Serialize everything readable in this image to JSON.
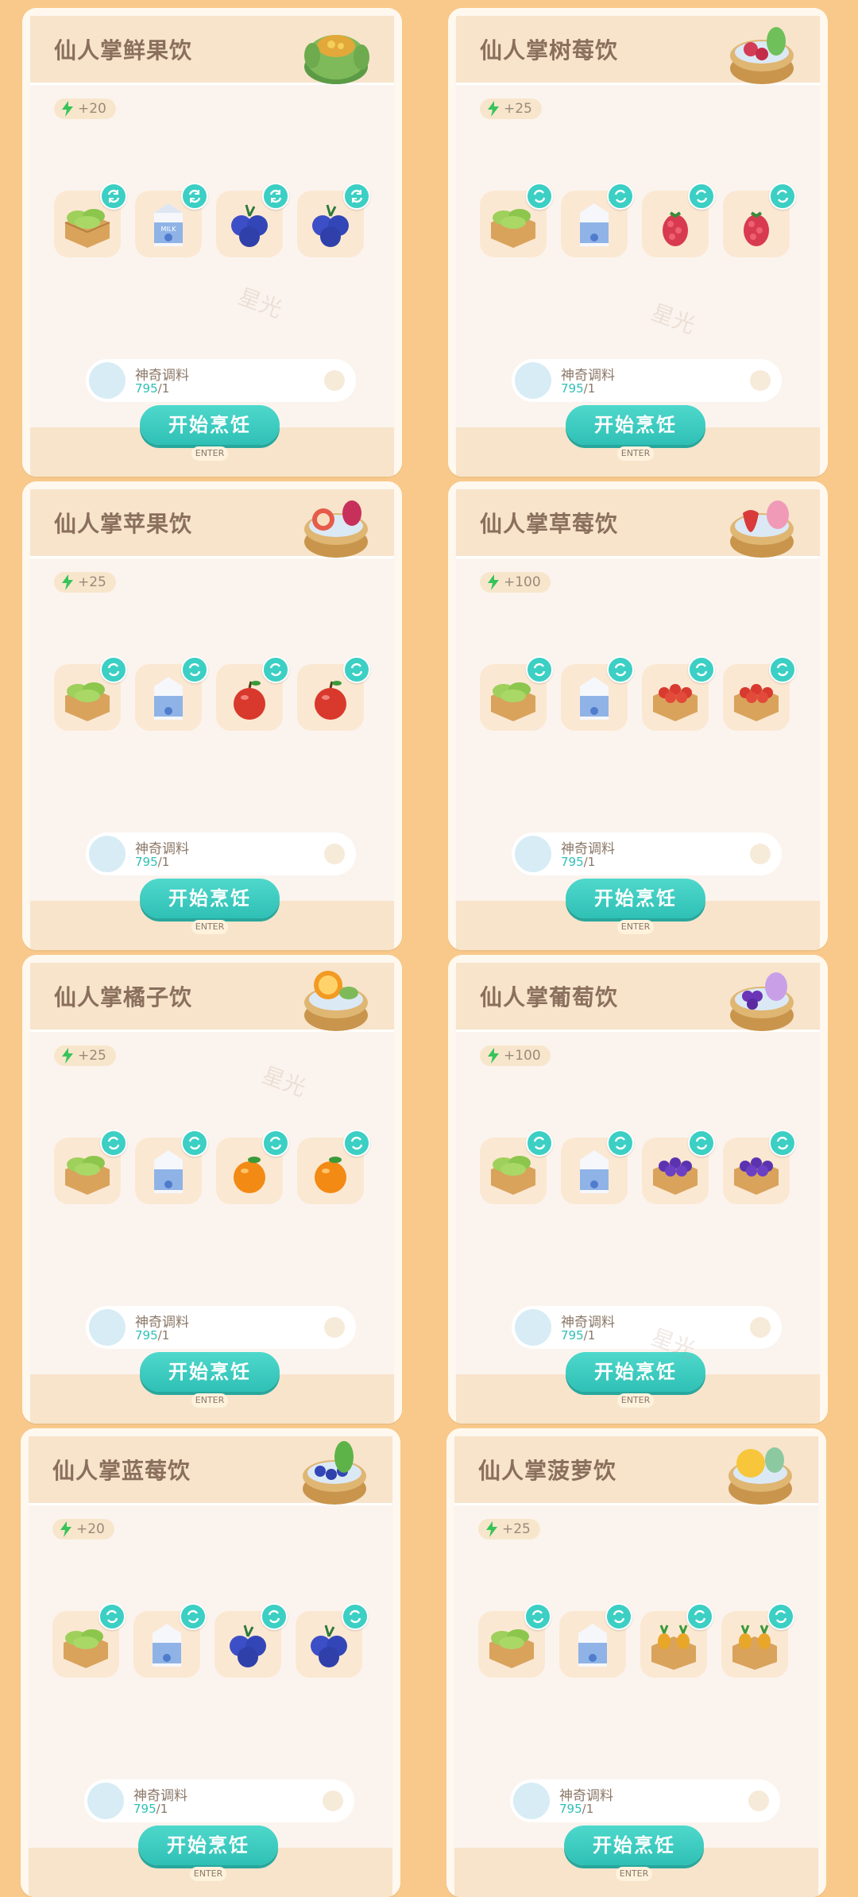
{
  "cards": [
    {
      "title": "仙人掌鲜果饮",
      "energy": "+20",
      "dish": "cactus-pot-icon",
      "ingredients": [
        "lettuce-crate-icon",
        "milk-carton-icon",
        "blueberry-icon",
        "blueberry-icon"
      ]
    },
    {
      "title": "仙人掌树莓饮",
      "energy": "+25",
      "dish": "raspberry-basket-icon",
      "ingredients": [
        "lettuce-crate-icon",
        "milk-carton-icon",
        "raspberry-icon",
        "raspberry-icon"
      ]
    },
    {
      "title": "仙人掌苹果饮",
      "energy": "+25",
      "dish": "apple-basket-icon",
      "ingredients": [
        "lettuce-crate-icon",
        "milk-carton-icon",
        "apple-icon",
        "apple-icon"
      ]
    },
    {
      "title": "仙人掌草莓饮",
      "energy": "+100",
      "dish": "strawberry-basket-icon",
      "ingredients": [
        "lettuce-crate-icon",
        "milk-carton-icon",
        "strawberry-crate-icon",
        "strawberry-crate-icon"
      ]
    },
    {
      "title": "仙人掌橘子饮",
      "energy": "+25",
      "dish": "orange-basket-icon",
      "ingredients": [
        "lettuce-crate-icon",
        "milk-carton-icon",
        "orange-icon",
        "orange-icon"
      ]
    },
    {
      "title": "仙人掌葡萄饮",
      "energy": "+100",
      "dish": "grape-basket-icon",
      "ingredients": [
        "lettuce-crate-icon",
        "milk-carton-icon",
        "grape-crate-icon",
        "grape-crate-icon"
      ]
    },
    {
      "title": "仙人掌蓝莓饮",
      "energy": "+20",
      "dish": "blueberry-basket-icon",
      "ingredients": [
        "lettuce-crate-icon",
        "milk-carton-icon",
        "blueberry-icon",
        "blueberry-icon"
      ]
    },
    {
      "title": "仙人掌菠萝饮",
      "energy": "+25",
      "dish": "pineapple-basket-icon",
      "ingredients": [
        "lettuce-crate-icon",
        "milk-carton-icon",
        "pineapple-crate-icon",
        "pineapple-crate-icon"
      ]
    }
  ],
  "seasoning": {
    "name": "神奇调料",
    "have": "795",
    "need": "/1"
  },
  "cook_button_label": "开始烹饪",
  "enter_label": "ENTER",
  "watermark": "星光",
  "colors": {
    "background": "#f8c98a",
    "accent": "#2fc0b5",
    "header": "#f7e4cb",
    "title": "#8a6f5d"
  }
}
